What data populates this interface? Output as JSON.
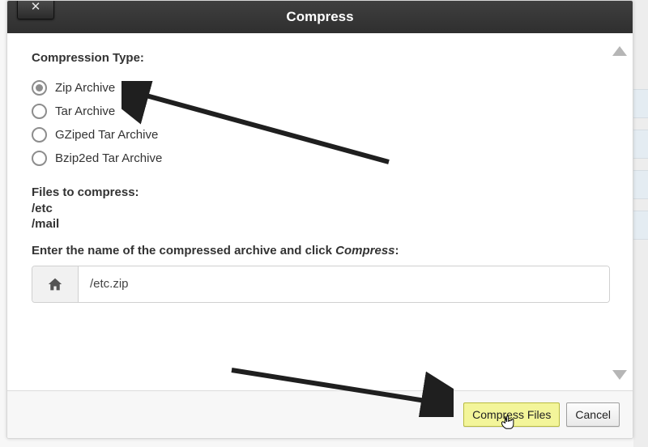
{
  "dialog": {
    "title": "Compress",
    "close_glyph": "✕"
  },
  "compression_type": {
    "label": "Compression Type:",
    "options": [
      {
        "label": "Zip Archive",
        "selected": true
      },
      {
        "label": "Tar Archive",
        "selected": false
      },
      {
        "label": "GZiped Tar Archive",
        "selected": false
      },
      {
        "label": "Bzip2ed Tar Archive",
        "selected": false
      }
    ]
  },
  "files_to_compress": {
    "label": "Files to compress:",
    "paths": [
      "/etc",
      "/mail"
    ]
  },
  "prompt": {
    "prefix": "Enter the name of the compressed archive and click ",
    "emph": "Compress",
    "suffix": ":"
  },
  "archive_input": {
    "value": "/etc.zip"
  },
  "footer": {
    "compress_label": "Compress Files",
    "cancel_label": "Cancel"
  }
}
